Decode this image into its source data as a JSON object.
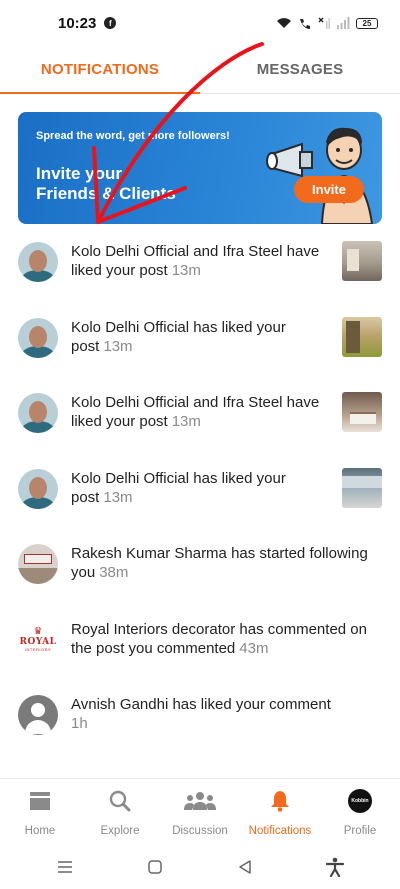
{
  "status_bar": {
    "time": "10:23",
    "app_badge": "f",
    "battery": "25"
  },
  "tabs": [
    {
      "label": "NOTIFICATIONS",
      "active": true
    },
    {
      "label": "MESSAGES",
      "active": false
    }
  ],
  "banner": {
    "tagline": "Spread the word, get more followers!",
    "headline_line1": "Invite your",
    "headline_line2": "Friends & Clients",
    "invite_label": "Invite"
  },
  "notifications": [
    {
      "text": "Kolo Delhi Official and Ifra Steel have liked your post",
      "time": "13m",
      "avatar": "person-avatar",
      "thumbnail": "interior-post-thumbnail"
    },
    {
      "text": "Kolo Delhi Official has liked your post",
      "time": "13m",
      "avatar": "person-avatar",
      "thumbnail": "interior-post-thumbnail"
    },
    {
      "text": "Kolo Delhi Official and Ifra Steel have liked your post",
      "time": "13m",
      "avatar": "person-avatar",
      "thumbnail": "bedroom-post-thumbnail"
    },
    {
      "text": "Kolo Delhi Official has liked your post",
      "time": "13m",
      "avatar": "person-avatar",
      "thumbnail": "living-room-post-thumbnail"
    },
    {
      "text": "Rakesh Kumar Sharma has started following you",
      "time": "38m",
      "avatar": "shop-avatar"
    },
    {
      "text": "Royal Interiors decorator has commented on the post you commented",
      "time": "43m",
      "avatar": "royal-logo-avatar",
      "logo_text": "ROYAL",
      "logo_subtext": "INTERIORS"
    },
    {
      "text": "Avnish Gandhi has liked your comment",
      "time": "1h",
      "avatar": "default-user-avatar"
    }
  ],
  "bottom_nav": [
    {
      "label": "Home",
      "icon": "home-icon",
      "active": false
    },
    {
      "label": "Explore",
      "icon": "search-icon",
      "active": false
    },
    {
      "label": "Discussion",
      "icon": "people-icon",
      "active": false
    },
    {
      "label": "Notifications",
      "icon": "bell-icon",
      "active": true
    },
    {
      "label": "Profile",
      "icon": "profile-avatar-icon",
      "active": false,
      "avatar_text": "Kobbin"
    }
  ],
  "colors": {
    "accent": "#f26a1b",
    "banner_blue": "#2b86d8",
    "annotation_red": "#e8141c"
  }
}
